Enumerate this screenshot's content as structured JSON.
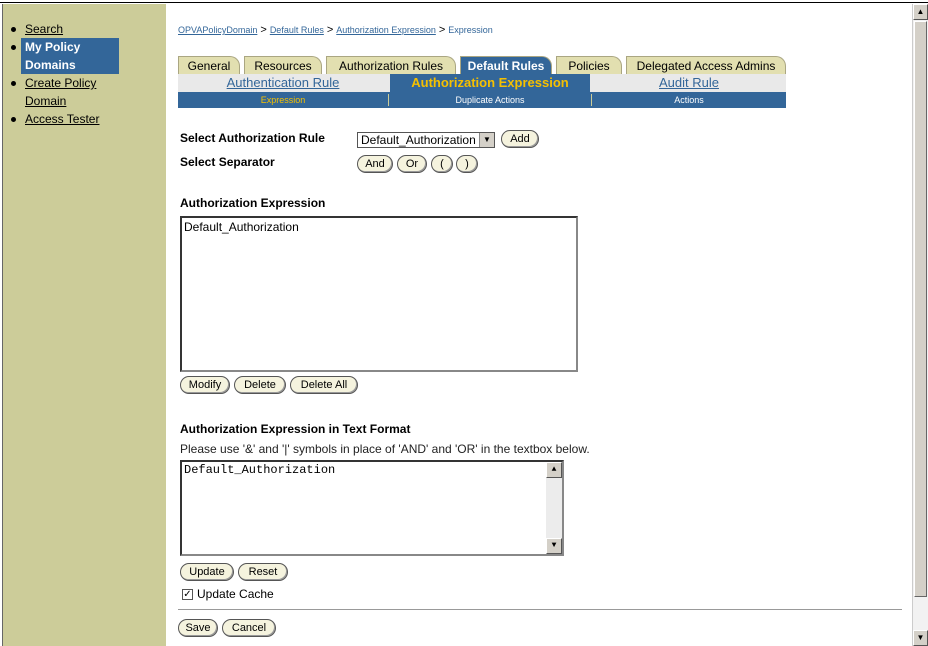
{
  "sidebar": {
    "items": [
      {
        "label": "Search"
      },
      {
        "label": "My Policy Domains"
      },
      {
        "label": "Create Policy Domain"
      },
      {
        "label": "Access Tester"
      }
    ]
  },
  "breadcrumb": {
    "items": [
      "OPVAPolicyDomain",
      "Default Rules",
      "Authorization Expression",
      "Expression"
    ],
    "separator": ">"
  },
  "tabs": [
    {
      "label": "General"
    },
    {
      "label": "Resources"
    },
    {
      "label": "Authorization Rules"
    },
    {
      "label": "Default Rules"
    },
    {
      "label": "Policies"
    },
    {
      "label": "Delegated Access Admins"
    }
  ],
  "subtabs": [
    {
      "label": "Authentication Rule"
    },
    {
      "label": "Authorization Expression"
    },
    {
      "label": "Audit Rule"
    }
  ],
  "subbar": [
    {
      "label": "Expression"
    },
    {
      "label": "Duplicate Actions"
    },
    {
      "label": "Actions"
    }
  ],
  "form": {
    "select_rule_label": "Select Authorization Rule",
    "select_rule_value": "Default_Authorization",
    "add_label": "Add",
    "select_separator_label": "Select Separator",
    "separators": [
      "And",
      "Or",
      "(",
      ")"
    ],
    "expression_heading": "Authorization Expression",
    "expression_items": [
      "Default_Authorization"
    ],
    "modify_label": "Modify",
    "delete_label": "Delete",
    "delete_all_label": "Delete All",
    "text_format_heading": "Authorization Expression in Text Format",
    "text_format_note": "Please use '&' and '|' symbols in place of 'AND' and 'OR' in the textbox below.",
    "text_format_value": "Default_Authorization",
    "update_label": "Update",
    "reset_label": "Reset",
    "update_cache_label": "Update Cache",
    "update_cache_checked": true,
    "save_label": "Save",
    "cancel_label": "Cancel"
  },
  "colors": {
    "sidebar_bg": "#cccc99",
    "accent": "#336699",
    "active_text": "#f5c000",
    "tab_bg": "#e2dfb0"
  }
}
